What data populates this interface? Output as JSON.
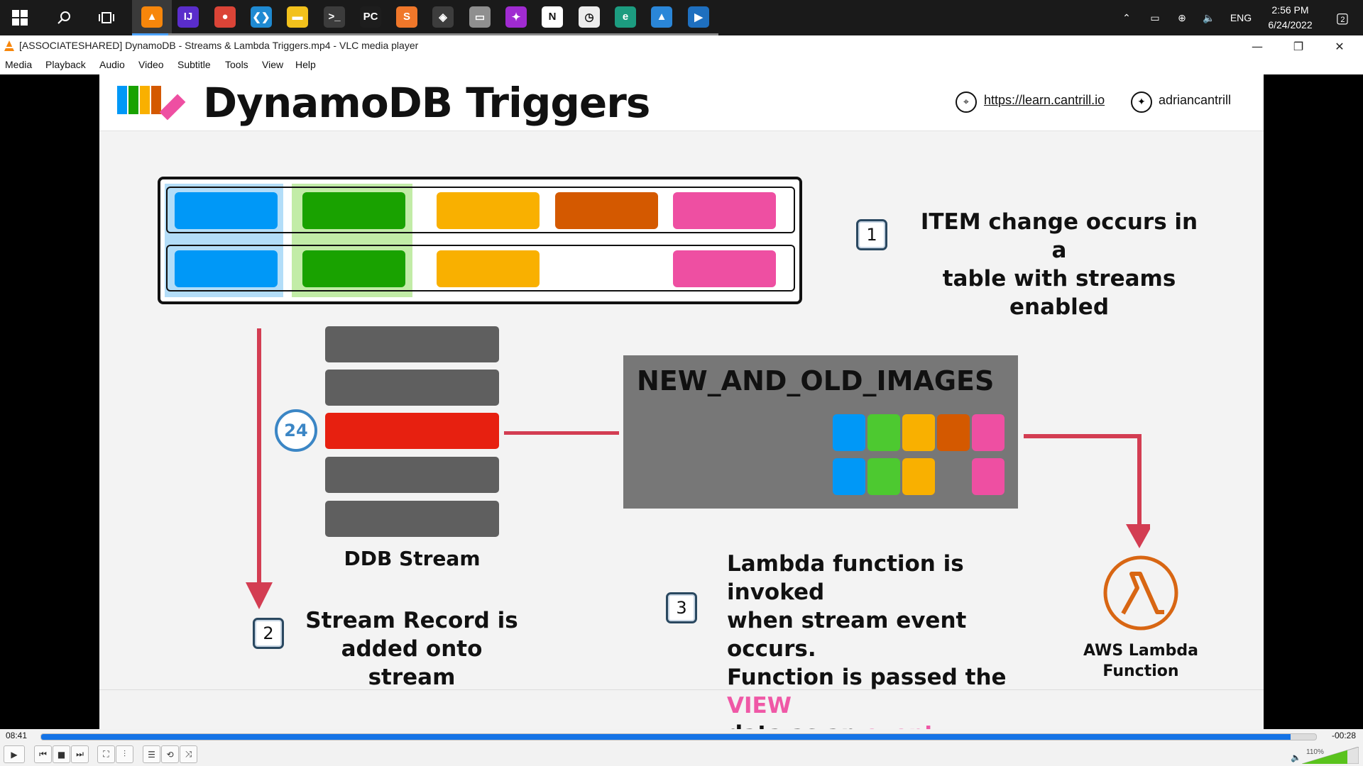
{
  "taskbar": {
    "clock_time": "2:56 PM",
    "clock_date": "6/24/2022",
    "language": "ENG",
    "notification_count": "2",
    "apps": [
      {
        "name": "vlc-icon",
        "glyph": "▲",
        "color": "#f7860b"
      },
      {
        "name": "intellij-icon",
        "glyph": "IJ",
        "color": "#5a2dcb"
      },
      {
        "name": "chrome-icon",
        "glyph": "●",
        "color": "#db4437"
      },
      {
        "name": "vscode-icon",
        "glyph": "❮❯",
        "color": "#1f8ad2"
      },
      {
        "name": "file-explorer-icon",
        "glyph": "▬",
        "color": "#f2c11c"
      },
      {
        "name": "terminal-icon",
        "glyph": ">_",
        "color": "#3c3c3c"
      },
      {
        "name": "pycharm-icon",
        "glyph": "PC",
        "color": "#1d1d1d"
      },
      {
        "name": "sublime-icon",
        "glyph": "S",
        "color": "#f0772a"
      },
      {
        "name": "security-icon",
        "glyph": "◈",
        "color": "#3d3d3d"
      },
      {
        "name": "scanner-icon",
        "glyph": "▭",
        "color": "#8f8f8f"
      },
      {
        "name": "davinci-icon",
        "glyph": "✦",
        "color": "#a02bd1"
      },
      {
        "name": "notion-icon",
        "glyph": "N",
        "color": "#ffffff"
      },
      {
        "name": "clock-app-icon",
        "glyph": "◷",
        "color": "#ececec"
      },
      {
        "name": "edge-icon",
        "glyph": "e",
        "color": "#1c9c80"
      },
      {
        "name": "photos-icon",
        "glyph": "▲",
        "color": "#2a86d8"
      },
      {
        "name": "video-editor-icon",
        "glyph": "▶",
        "color": "#1e6fbf"
      }
    ]
  },
  "window": {
    "title": "[ASSOCIATESHARED] DynamoDB - Streams & Lambda Triggers.mp4 - VLC media player"
  },
  "menu": [
    "Media",
    "Playback",
    "Audio",
    "Video",
    "Subtitle",
    "Tools",
    "View",
    "Help"
  ],
  "slide": {
    "title": "DynamoDB Triggers",
    "link": "https://learn.cantrill.io",
    "twitter": "adriancantrill",
    "step1_num": "1",
    "step1_line1": "ITEM change occurs in a",
    "step1_line2": "table with streams enabled",
    "retention": "24",
    "stream_label": "DDB Stream",
    "step2_num": "2",
    "step2_line1": "Stream Record is",
    "step2_line2": "added onto stream",
    "view_type": "NEW_AND_OLD_IMAGES",
    "step3_num": "3",
    "step3_line1": "Lambda function is invoked",
    "step3_line2": "when stream event occurs.",
    "step3_line3a": "Function is passed the ",
    "step3_line3b": "VIEW",
    "step3_line4a": "data as an ",
    "step3_line4b": "event",
    "lambda_line1": "AWS Lambda",
    "lambda_line2": "Function",
    "colors": {
      "blue": "#0098f7",
      "green": "#19a200",
      "yellow": "#f9b000",
      "orange": "#d45900",
      "pink": "#ee4fa2",
      "red": "#e72010",
      "accent_pink": "#ef58a6"
    }
  },
  "player": {
    "elapsed": "08:41",
    "remaining": "-00:28",
    "progress_fraction": 0.98,
    "volume": "110%",
    "volume_fraction": 0.8
  }
}
